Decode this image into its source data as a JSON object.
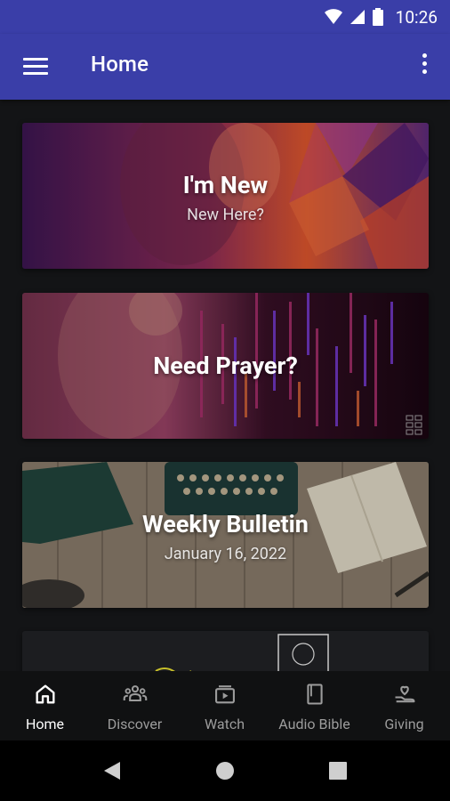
{
  "status_bar": {
    "time": "10:26"
  },
  "app_bar": {
    "title": "Home"
  },
  "cards": [
    {
      "title": "I'm New",
      "subtitle": "New Here?"
    },
    {
      "title": "Need Prayer?"
    },
    {
      "title": "Weekly Bulletin",
      "subtitle": "January 16, 2022"
    }
  ],
  "bottom_nav": [
    {
      "label": "Home",
      "icon": "home-icon",
      "active": true
    },
    {
      "label": "Discover",
      "icon": "people-icon",
      "active": false
    },
    {
      "label": "Watch",
      "icon": "video-library-icon",
      "active": false
    },
    {
      "label": "Audio Bible",
      "icon": "book-icon",
      "active": false
    },
    {
      "label": "Giving",
      "icon": "heart-hand-icon",
      "active": false
    }
  ],
  "colors": {
    "app_bar": "#3a3ea8",
    "background": "#131416",
    "nav_active": "#ffffff",
    "nav_inactive": "#9c9c9c"
  }
}
